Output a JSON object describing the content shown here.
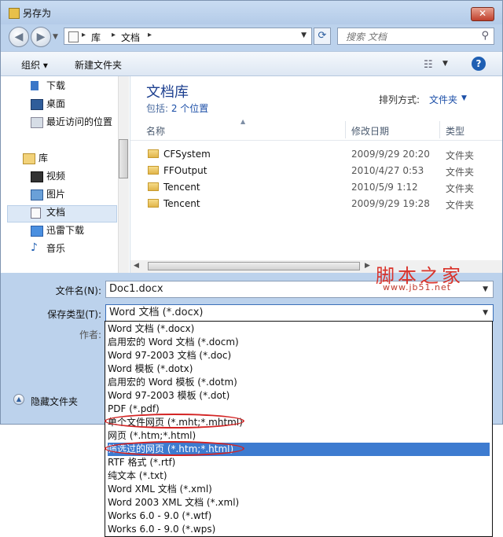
{
  "window": {
    "title": "另存为",
    "close_symbol": "✕"
  },
  "nav": {
    "back_symbol": "◀",
    "forward_symbol": "▶"
  },
  "address": {
    "crumbs": [
      "库",
      "文档"
    ],
    "separator": "▸"
  },
  "search": {
    "placeholder": "搜索 文档"
  },
  "toolbar": {
    "organize": "组织 ▾",
    "new_folder": "新建文件夹",
    "view_symbol": "☷",
    "help_symbol": "?"
  },
  "sidebar": {
    "items": [
      {
        "label": "下载",
        "icon": "download-folder-icon"
      },
      {
        "label": "桌面",
        "icon": "desktop-icon"
      },
      {
        "label": "最近访问的位置",
        "icon": "recent-places-icon"
      },
      {
        "label": "库",
        "icon": "library-icon"
      },
      {
        "label": "视频",
        "icon": "videos-icon"
      },
      {
        "label": "图片",
        "icon": "pictures-icon"
      },
      {
        "label": "文档",
        "icon": "documents-icon",
        "selected": true
      },
      {
        "label": "迅雷下载",
        "icon": "thunder-download-icon"
      },
      {
        "label": "音乐",
        "icon": "music-icon"
      }
    ]
  },
  "library": {
    "title": "文档库",
    "includes_label": "包括: ",
    "includes_value": "2 个位置",
    "arrange_label": "排列方式:",
    "arrange_value": "文件夹"
  },
  "columns": {
    "name": "名称",
    "modified": "修改日期",
    "type": "类型"
  },
  "files": [
    {
      "name": "CFSystem",
      "modified": "2009/9/29 20:20",
      "type": "文件夹"
    },
    {
      "name": "FFOutput",
      "modified": "2010/4/27 0:53",
      "type": "文件夹"
    },
    {
      "name": "Tencent",
      "modified": "2010/5/9 1:12",
      "type": "文件夹"
    },
    {
      "name": "Tencent",
      "modified": "2009/9/29 19:28",
      "type": "文件夹"
    }
  ],
  "watermark": {
    "logo": "脚本之家",
    "url": "www.jb51.net"
  },
  "form": {
    "filename_label": "文件名(N):",
    "filename_value": "Doc1.docx",
    "savetype_label": "保存类型(T):",
    "savetype_value": "Word 文档 (*.docx)",
    "author_label": "作者:",
    "hide_folders_label": "隐藏文件夹"
  },
  "savetype_options": [
    "Word 文档 (*.docx)",
    "启用宏的 Word 文档 (*.docm)",
    "Word 97-2003 文档 (*.doc)",
    "Word 模板 (*.dotx)",
    "启用宏的 Word 模板 (*.dotm)",
    "Word 97-2003 模板 (*.dot)",
    "PDF (*.pdf)",
    "单个文件网页 (*.mht;*.mhtml)",
    "网页 (*.htm;*.html)",
    "筛选过的网页 (*.htm;*.html)",
    "RTF 格式 (*.rtf)",
    "纯文本 (*.txt)",
    "Word XML 文档 (*.xml)",
    "Word 2003 XML 文档 (*.xml)",
    "Works 6.0 - 9.0 (*.wtf)",
    "Works 6.0 - 9.0 (*.wps)"
  ],
  "selected_option_index": 9,
  "colors": {
    "accent": "#3d7bd0",
    "annotation_circle": "#d32424",
    "watermark": "#d9322a"
  }
}
